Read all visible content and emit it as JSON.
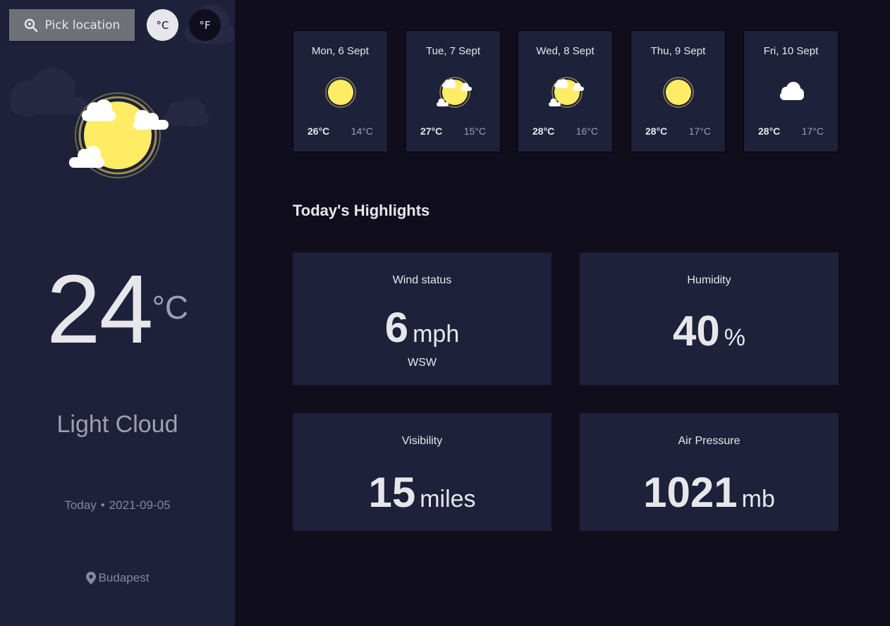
{
  "header": {
    "pick_location_label": "Pick location",
    "unit_celsius": "°C",
    "unit_fahrenheit": "°F",
    "active_unit": "celsius"
  },
  "current": {
    "temp": "24",
    "unit": "°C",
    "condition": "Light Cloud",
    "date_prefix": "Today",
    "separator": "•",
    "date": "2021-09-05",
    "location": "Budapest",
    "icon": "light-cloud-icon"
  },
  "forecast": [
    {
      "date": "Mon, 6 Sept",
      "max": "26°C",
      "min": "14°C",
      "icon": "clear-icon"
    },
    {
      "date": "Tue, 7 Sept",
      "max": "27°C",
      "min": "15°C",
      "icon": "light-cloud-icon"
    },
    {
      "date": "Wed, 8 Sept",
      "max": "28°C",
      "min": "16°C",
      "icon": "light-cloud-icon"
    },
    {
      "date": "Thu, 9 Sept",
      "max": "28°C",
      "min": "17°C",
      "icon": "clear-icon"
    },
    {
      "date": "Fri, 10 Sept",
      "max": "28°C",
      "min": "17°C",
      "icon": "heavy-cloud-icon"
    }
  ],
  "highlights": {
    "title": "Today's Highlights",
    "wind": {
      "label": "Wind status",
      "value": "6",
      "unit": "mph",
      "direction": "WSW"
    },
    "humidity": {
      "label": "Humidity",
      "value": "40",
      "unit": "%"
    },
    "visibility": {
      "label": "Visibility",
      "value": "15",
      "unit": "miles"
    },
    "pressure": {
      "label": "Air Pressure",
      "value": "1021",
      "unit": "mb"
    }
  },
  "colors": {
    "background": "#100e1d",
    "sidebar": "#1e213a",
    "card": "#1e213a",
    "sun": "#ffec65",
    "text_primary": "#e7e7eb",
    "text_secondary": "#a09fb1"
  }
}
